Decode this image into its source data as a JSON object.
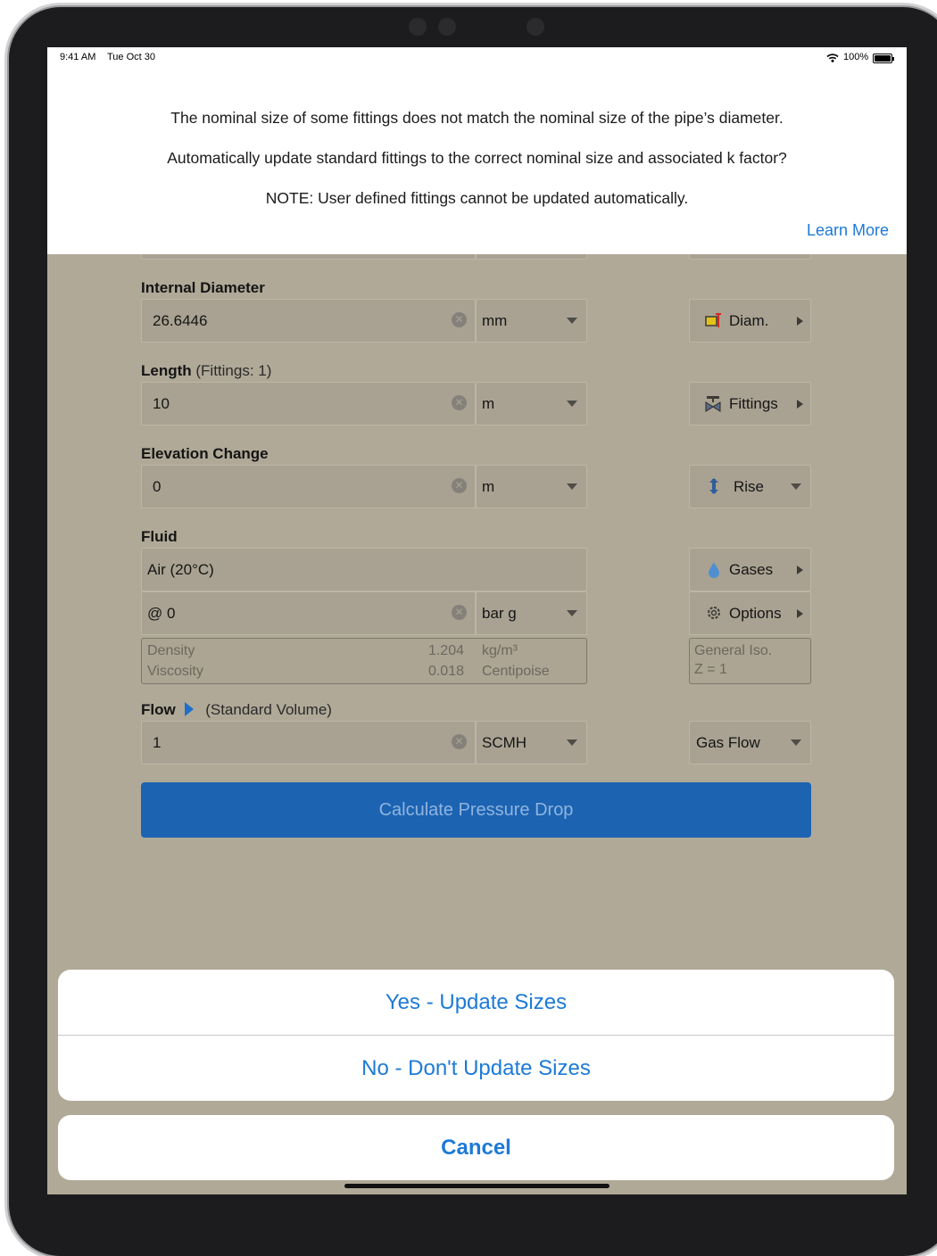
{
  "status_bar": {
    "time": "9:41 AM",
    "date": "Tue Oct 30",
    "battery": "100%"
  },
  "alert": {
    "line1": "The nominal size of some fittings does not match the nominal size of the pipe’s diameter.",
    "line2": "Automatically update standard fittings to the correct nominal size and associated k factor?",
    "line3": "NOTE: User defined fittings cannot be updated automatically.",
    "learn_more": "Learn More"
  },
  "form": {
    "internal_diameter": {
      "label": "Internal Diameter",
      "value": "26.6446",
      "unit": "mm",
      "button": "Diam."
    },
    "length": {
      "label": "Length",
      "sub": "(Fittings: 1)",
      "value": "10",
      "unit": "m",
      "button": "Fittings"
    },
    "elevation": {
      "label": "Elevation Change",
      "value": "0",
      "unit": "m",
      "button": "Rise"
    },
    "fluid": {
      "label": "Fluid",
      "name": "Air (20°C)",
      "pressure_prefix": "@",
      "pressure": "0",
      "pressure_unit": "bar g",
      "gases_button": "Gases",
      "options_button": "Options",
      "density_label": "Density",
      "density_value": "1.204",
      "density_unit": "kg/m³",
      "viscosity_label": "Viscosity",
      "viscosity_value": "0.018",
      "viscosity_unit": "Centipoise",
      "iso_line1": "General Iso.",
      "iso_line2": "Z = 1"
    },
    "flow": {
      "label": "Flow",
      "sub": "(Standard Volume)",
      "value": "1",
      "unit": "SCMH",
      "button": "Gas Flow"
    },
    "calculate": "Calculate Pressure Drop"
  },
  "action_sheet": {
    "yes": "Yes - Update Sizes",
    "no": "No - Don't Update Sizes",
    "cancel": "Cancel"
  },
  "colors": {
    "accent": "#1d7ad7",
    "calc_button": "#1c63b2",
    "dim_background": "#b0a998"
  }
}
